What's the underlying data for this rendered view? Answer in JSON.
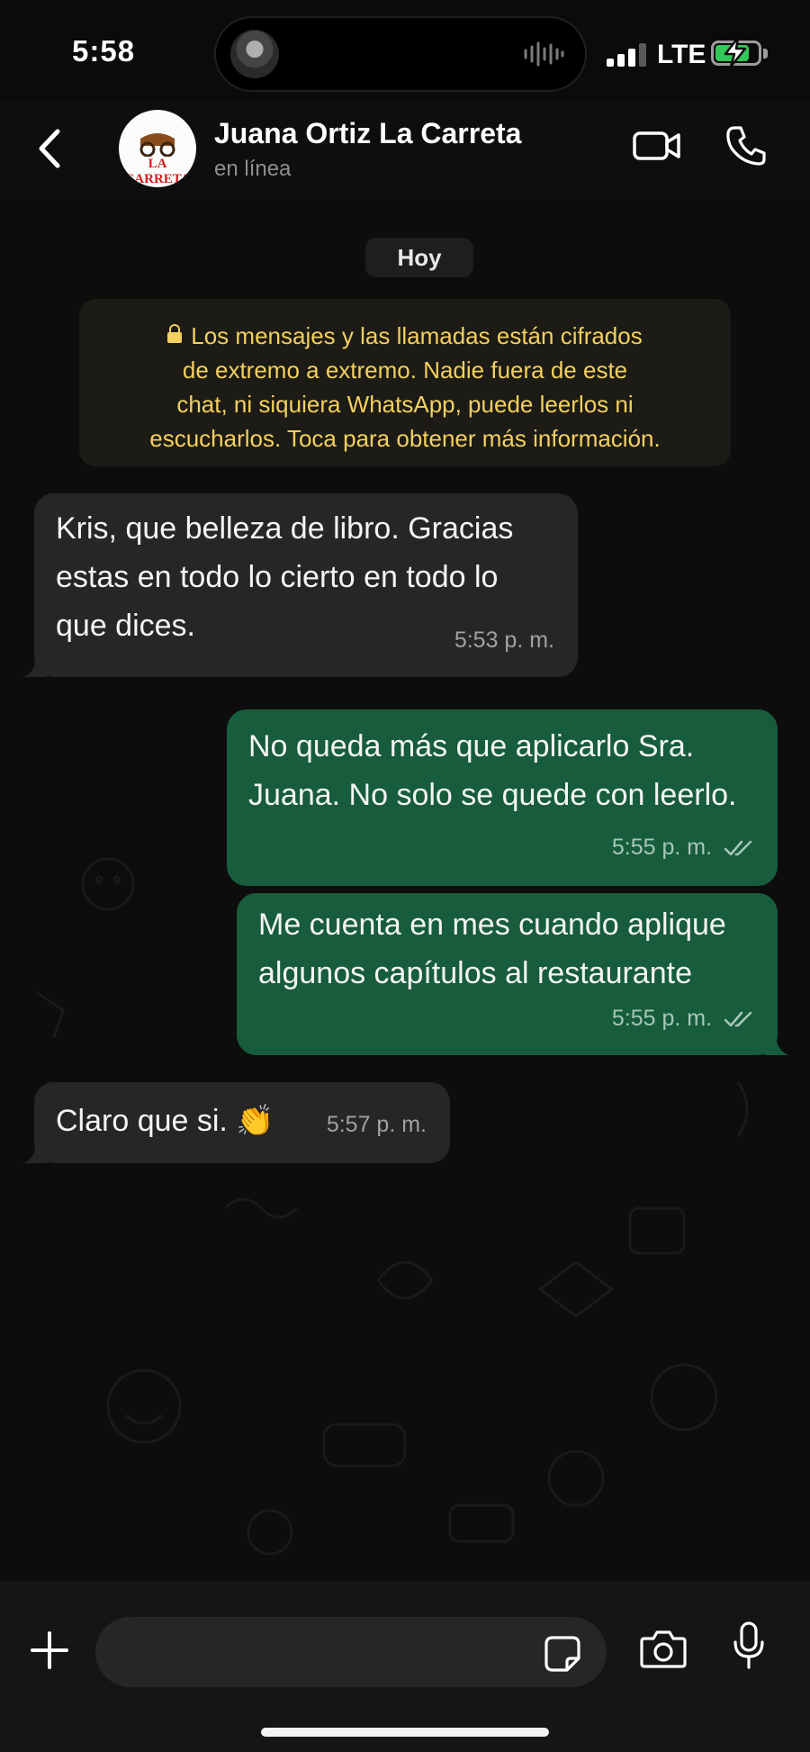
{
  "status_bar": {
    "time": "5:58",
    "network": "LTE",
    "battery_level": 0.8
  },
  "header": {
    "contact_name": "Juana Ortiz La Carreta",
    "status": "en línea",
    "avatar_text": "LA CARRETA"
  },
  "chat": {
    "date_label": "Hoy",
    "encryption_notice": [
      "Los mensajes y las llamadas están cifrados",
      "de extremo a extremo. Nadie fuera de este",
      "chat, ni siquiera WhatsApp, puede leerlos ni",
      "escucharlos. Toca para obtener más información."
    ],
    "messages": [
      {
        "direction": "incoming",
        "lines": [
          "Kris, que belleza de libro. Gracias",
          "estas en todo lo cierto en todo lo",
          "que dices."
        ],
        "time": "5:53 p. m."
      },
      {
        "direction": "outgoing",
        "lines": [
          "No queda más que aplicarlo Sra.",
          "Juana. No solo se quede con leerlo."
        ],
        "time": "5:55 p. m.",
        "status": "read"
      },
      {
        "direction": "outgoing",
        "lines": [
          "Me cuenta en mes cuando aplique",
          "algunos capítulos al restaurante"
        ],
        "time": "5:55 p. m.",
        "status": "read"
      },
      {
        "direction": "incoming",
        "lines": [
          "Claro que si. 👏"
        ],
        "time": "5:57 p. m."
      }
    ]
  },
  "composer": {
    "placeholder": ""
  },
  "colors": {
    "incoming_bubble": "#262626",
    "outgoing_bubble": "#175c3c",
    "notice_text": "#f3d060",
    "background": "#0d0d0d"
  }
}
